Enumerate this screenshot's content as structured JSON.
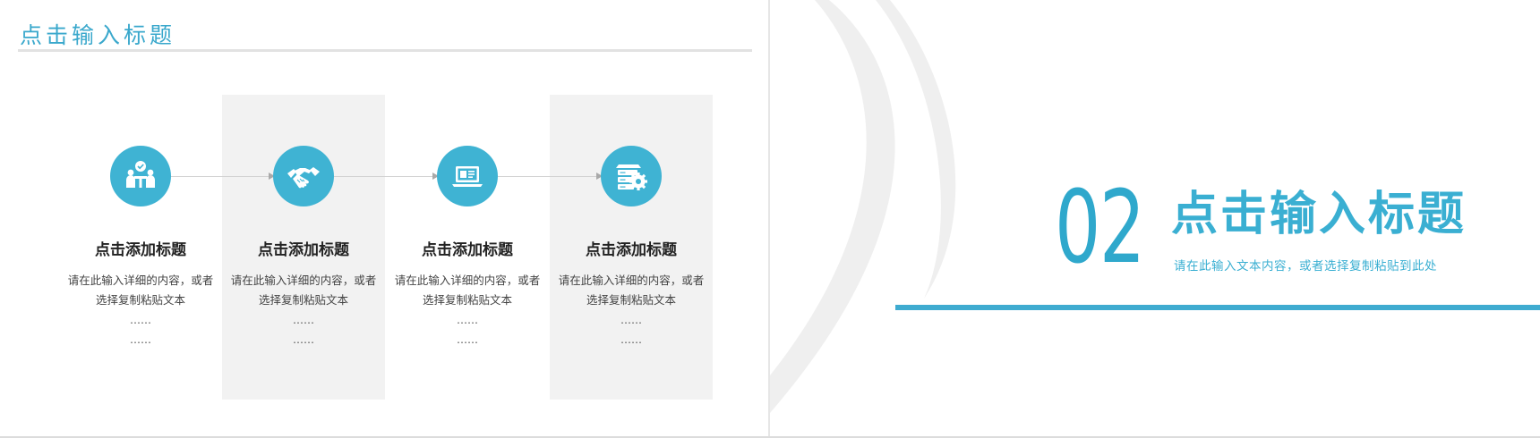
{
  "left_slide": {
    "title": "点击输入标题",
    "steps": [
      {
        "icon": "team-checkmark-icon",
        "title": "点击添加标题",
        "desc_line1": "请在此输入详细的内容，或者",
        "desc_line2": "选择复制粘贴文本",
        "dots1": "……",
        "dots2": "……"
      },
      {
        "icon": "handshake-icon",
        "title": "点击添加标题",
        "desc_line1": "请在此输入详细的内容，或者",
        "desc_line2": "选择复制粘贴文本",
        "dots1": "……",
        "dots2": "……"
      },
      {
        "icon": "laptop-icon",
        "title": "点击添加标题",
        "desc_line1": "请在此输入详细的内容，或者",
        "desc_line2": "选择复制粘贴文本",
        "dots1": "……",
        "dots2": "……"
      },
      {
        "icon": "server-gear-icon",
        "title": "点击添加标题",
        "desc_line1": "请在此输入详细的内容，或者",
        "desc_line2": "选择复制粘贴文本",
        "dots1": "……",
        "dots2": "……"
      }
    ]
  },
  "right_slide": {
    "number": "02",
    "title": "点击输入标题",
    "subtitle": "请在此输入文本内容，或者选择复制粘贴到此处"
  },
  "colors": {
    "accent": "#3fb3d3",
    "title_blue": "#3aa8cc",
    "panel_gray": "#f2f2f2",
    "arc_gray": "#efefef"
  }
}
